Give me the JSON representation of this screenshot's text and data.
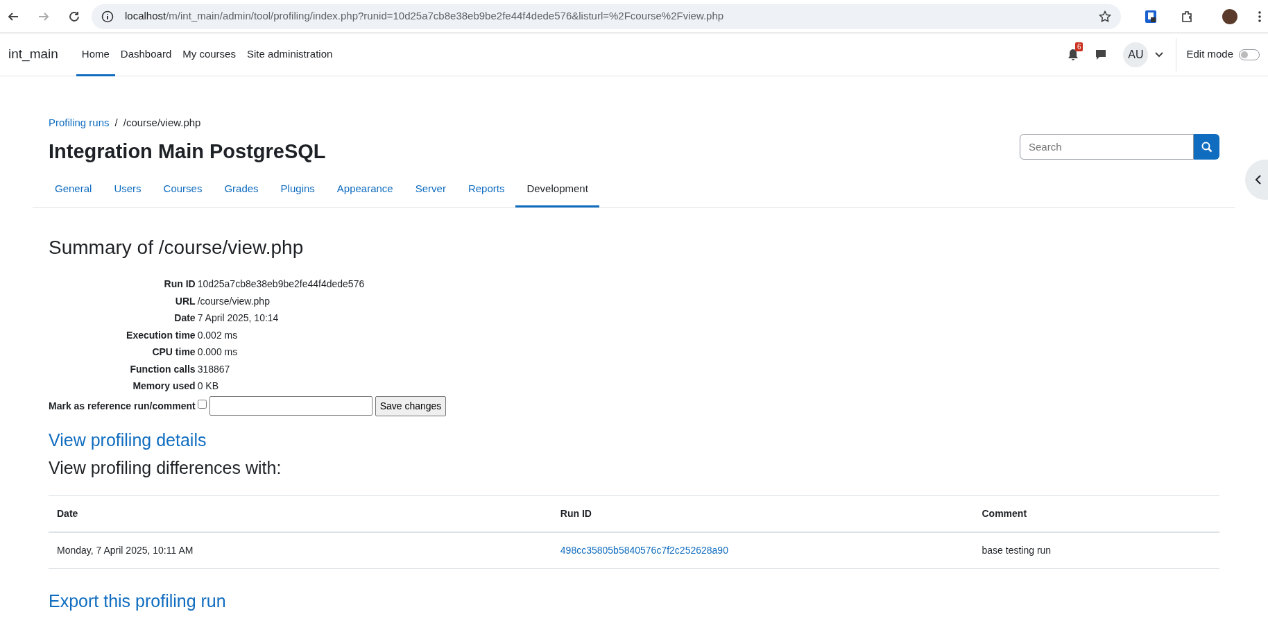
{
  "browser": {
    "url_host": "localhost",
    "url_path": "/m/int_main/admin/tool/profiling/index.php?runid=10d25a7cb8e38eb9be2fe44f4dede576&listurl=%2Fcourse%2Fview.php"
  },
  "navbar": {
    "brand": "int_main",
    "items": [
      {
        "label": "Home",
        "selected": true
      },
      {
        "label": "Dashboard",
        "selected": false
      },
      {
        "label": "My courses",
        "selected": false
      },
      {
        "label": "Site administration",
        "selected": false
      }
    ],
    "notification_count": "6",
    "user_initials": "AU",
    "edit_mode": {
      "label": "Edit mode",
      "on": false
    }
  },
  "breadcrumb": [
    {
      "label": "Profiling runs",
      "kind": "link"
    },
    {
      "label": "/",
      "kind": "separator"
    },
    {
      "label": "/course/view.php",
      "kind": "current"
    }
  ],
  "page_title": "Integration Main PostgreSQL",
  "search": {
    "placeholder": "Search"
  },
  "tabs": [
    {
      "label": "General",
      "selected": false
    },
    {
      "label": "Users",
      "selected": false
    },
    {
      "label": "Courses",
      "selected": false
    },
    {
      "label": "Grades",
      "selected": false
    },
    {
      "label": "Plugins",
      "selected": false
    },
    {
      "label": "Appearance",
      "selected": false
    },
    {
      "label": "Server",
      "selected": false
    },
    {
      "label": "Reports",
      "selected": false
    },
    {
      "label": "Development",
      "selected": true
    }
  ],
  "summary": {
    "heading": "Summary of /course/view.php",
    "fields": [
      {
        "label": "Run ID",
        "value": "10d25a7cb8e38eb9be2fe44f4dede576"
      },
      {
        "label": "URL",
        "value": "/course/view.php"
      },
      {
        "label": "Date",
        "value": "7 April 2025, 10:14"
      },
      {
        "label": "Execution time",
        "value": "0.002 ms"
      },
      {
        "label": "CPU time",
        "value": "0.000 ms"
      },
      {
        "label": "Function calls",
        "value": "318867"
      },
      {
        "label": "Memory used",
        "value": "0 KB"
      }
    ],
    "reference": {
      "label": "Mark as reference run/comment",
      "checked": false,
      "button": "Save changes"
    }
  },
  "details_link": "View profiling details",
  "differences_heading": "View profiling differences with:",
  "table": {
    "columns": [
      "Date",
      "Run ID",
      "Comment"
    ],
    "rows": [
      [
        "Monday, 7 April 2025, 10:11 AM",
        "498cc35805b5840576c7f2c252628a90",
        "base testing run"
      ]
    ]
  },
  "export_link": "Export this profiling run"
}
